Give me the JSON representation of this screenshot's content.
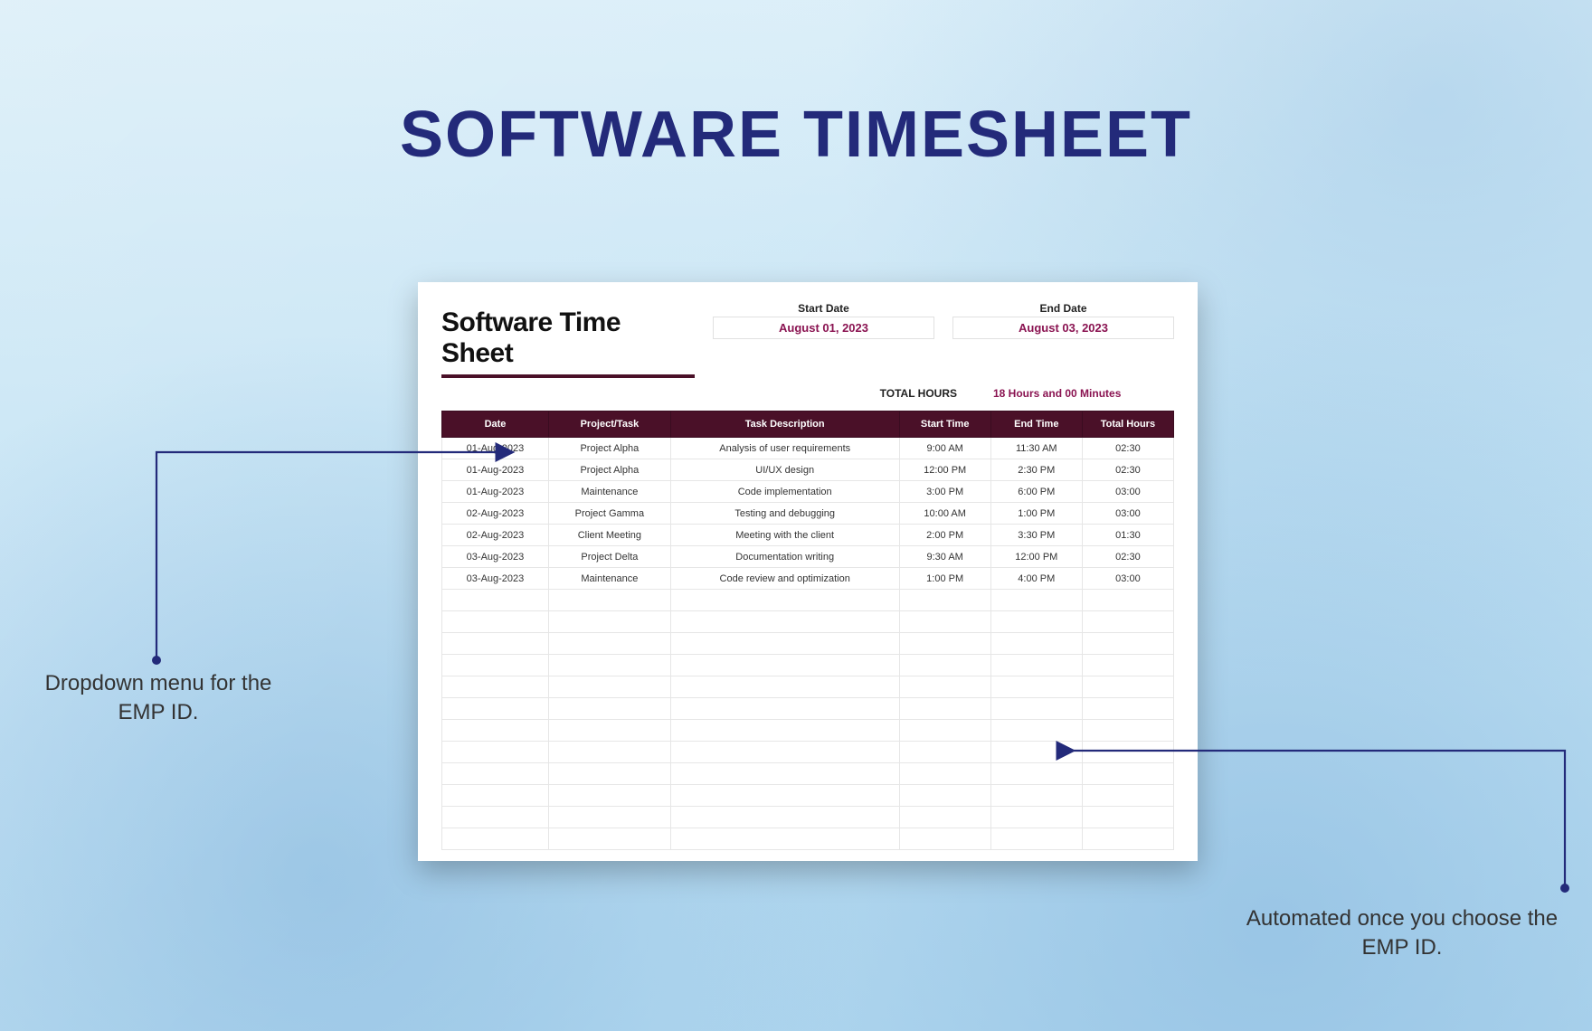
{
  "page_title": "SOFTWARE TIMESHEET",
  "sheet": {
    "heading": "Software Time Sheet",
    "start_date_label": "Start Date",
    "start_date_value": "August 01, 2023",
    "end_date_label": "End Date",
    "end_date_value": "August 03, 2023",
    "total_label": "TOTAL HOURS",
    "total_value": "18 Hours and 00 Minutes",
    "columns": {
      "date": "Date",
      "project": "Project/Task",
      "desc": "Task Description",
      "start": "Start Time",
      "end": "End Time",
      "hours": "Total Hours"
    },
    "rows": [
      {
        "date": "01-Aug-2023",
        "project": "Project Alpha",
        "desc": "Analysis of user requirements",
        "start": "9:00 AM",
        "end": "11:30 AM",
        "hours": "02:30"
      },
      {
        "date": "01-Aug-2023",
        "project": "Project Alpha",
        "desc": "UI/UX design",
        "start": "12:00 PM",
        "end": "2:30 PM",
        "hours": "02:30"
      },
      {
        "date": "01-Aug-2023",
        "project": "Maintenance",
        "desc": "Code implementation",
        "start": "3:00 PM",
        "end": "6:00 PM",
        "hours": "03:00"
      },
      {
        "date": "02-Aug-2023",
        "project": "Project Gamma",
        "desc": "Testing and debugging",
        "start": "10:00 AM",
        "end": "1:00 PM",
        "hours": "03:00"
      },
      {
        "date": "02-Aug-2023",
        "project": "Client Meeting",
        "desc": "Meeting with the client",
        "start": "2:00 PM",
        "end": "3:30 PM",
        "hours": "01:30"
      },
      {
        "date": "03-Aug-2023",
        "project": "Project Delta",
        "desc": "Documentation writing",
        "start": "9:30 AM",
        "end": "12:00 PM",
        "hours": "02:30"
      },
      {
        "date": "03-Aug-2023",
        "project": "Maintenance",
        "desc": "Code review and optimization",
        "start": "1:00 PM",
        "end": "4:00 PM",
        "hours": "03:00"
      }
    ],
    "empty_rows": 12
  },
  "annotations": {
    "left": "Dropdown menu for the EMP ID.",
    "right": "Automated once you choose the EMP ID."
  },
  "colors": {
    "title": "#232a7a",
    "header_bg": "#4a1028",
    "accent": "#8a1351",
    "callout": "#232a7a"
  }
}
